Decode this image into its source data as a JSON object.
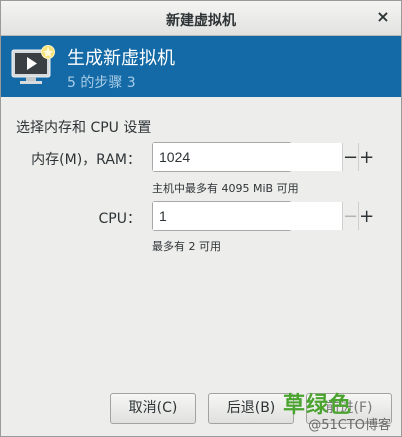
{
  "window": {
    "title": "新建虚拟机",
    "close_glyph": "×"
  },
  "header": {
    "title": "生成新虚拟机",
    "subtitle": "5 的步骤 3",
    "icon": "monitor-play-icon",
    "accent": "#136aa6"
  },
  "section": {
    "label": "选择内存和 CPU 设置"
  },
  "memory": {
    "label": "内存(M)，RAM：",
    "value": "1024",
    "hint": "主机中最多有 4095 MiB 可用",
    "minus": "−",
    "plus": "+"
  },
  "cpu": {
    "label": "CPU：",
    "value": "1",
    "hint": "最多有 2 可用",
    "minus": "−",
    "plus": "+"
  },
  "buttons": {
    "cancel": "取消(C)",
    "back": "后退(B)",
    "forward": "前进(F)"
  },
  "watermark": {
    "main": "草绿色",
    "sub": "@51CTO博客"
  }
}
